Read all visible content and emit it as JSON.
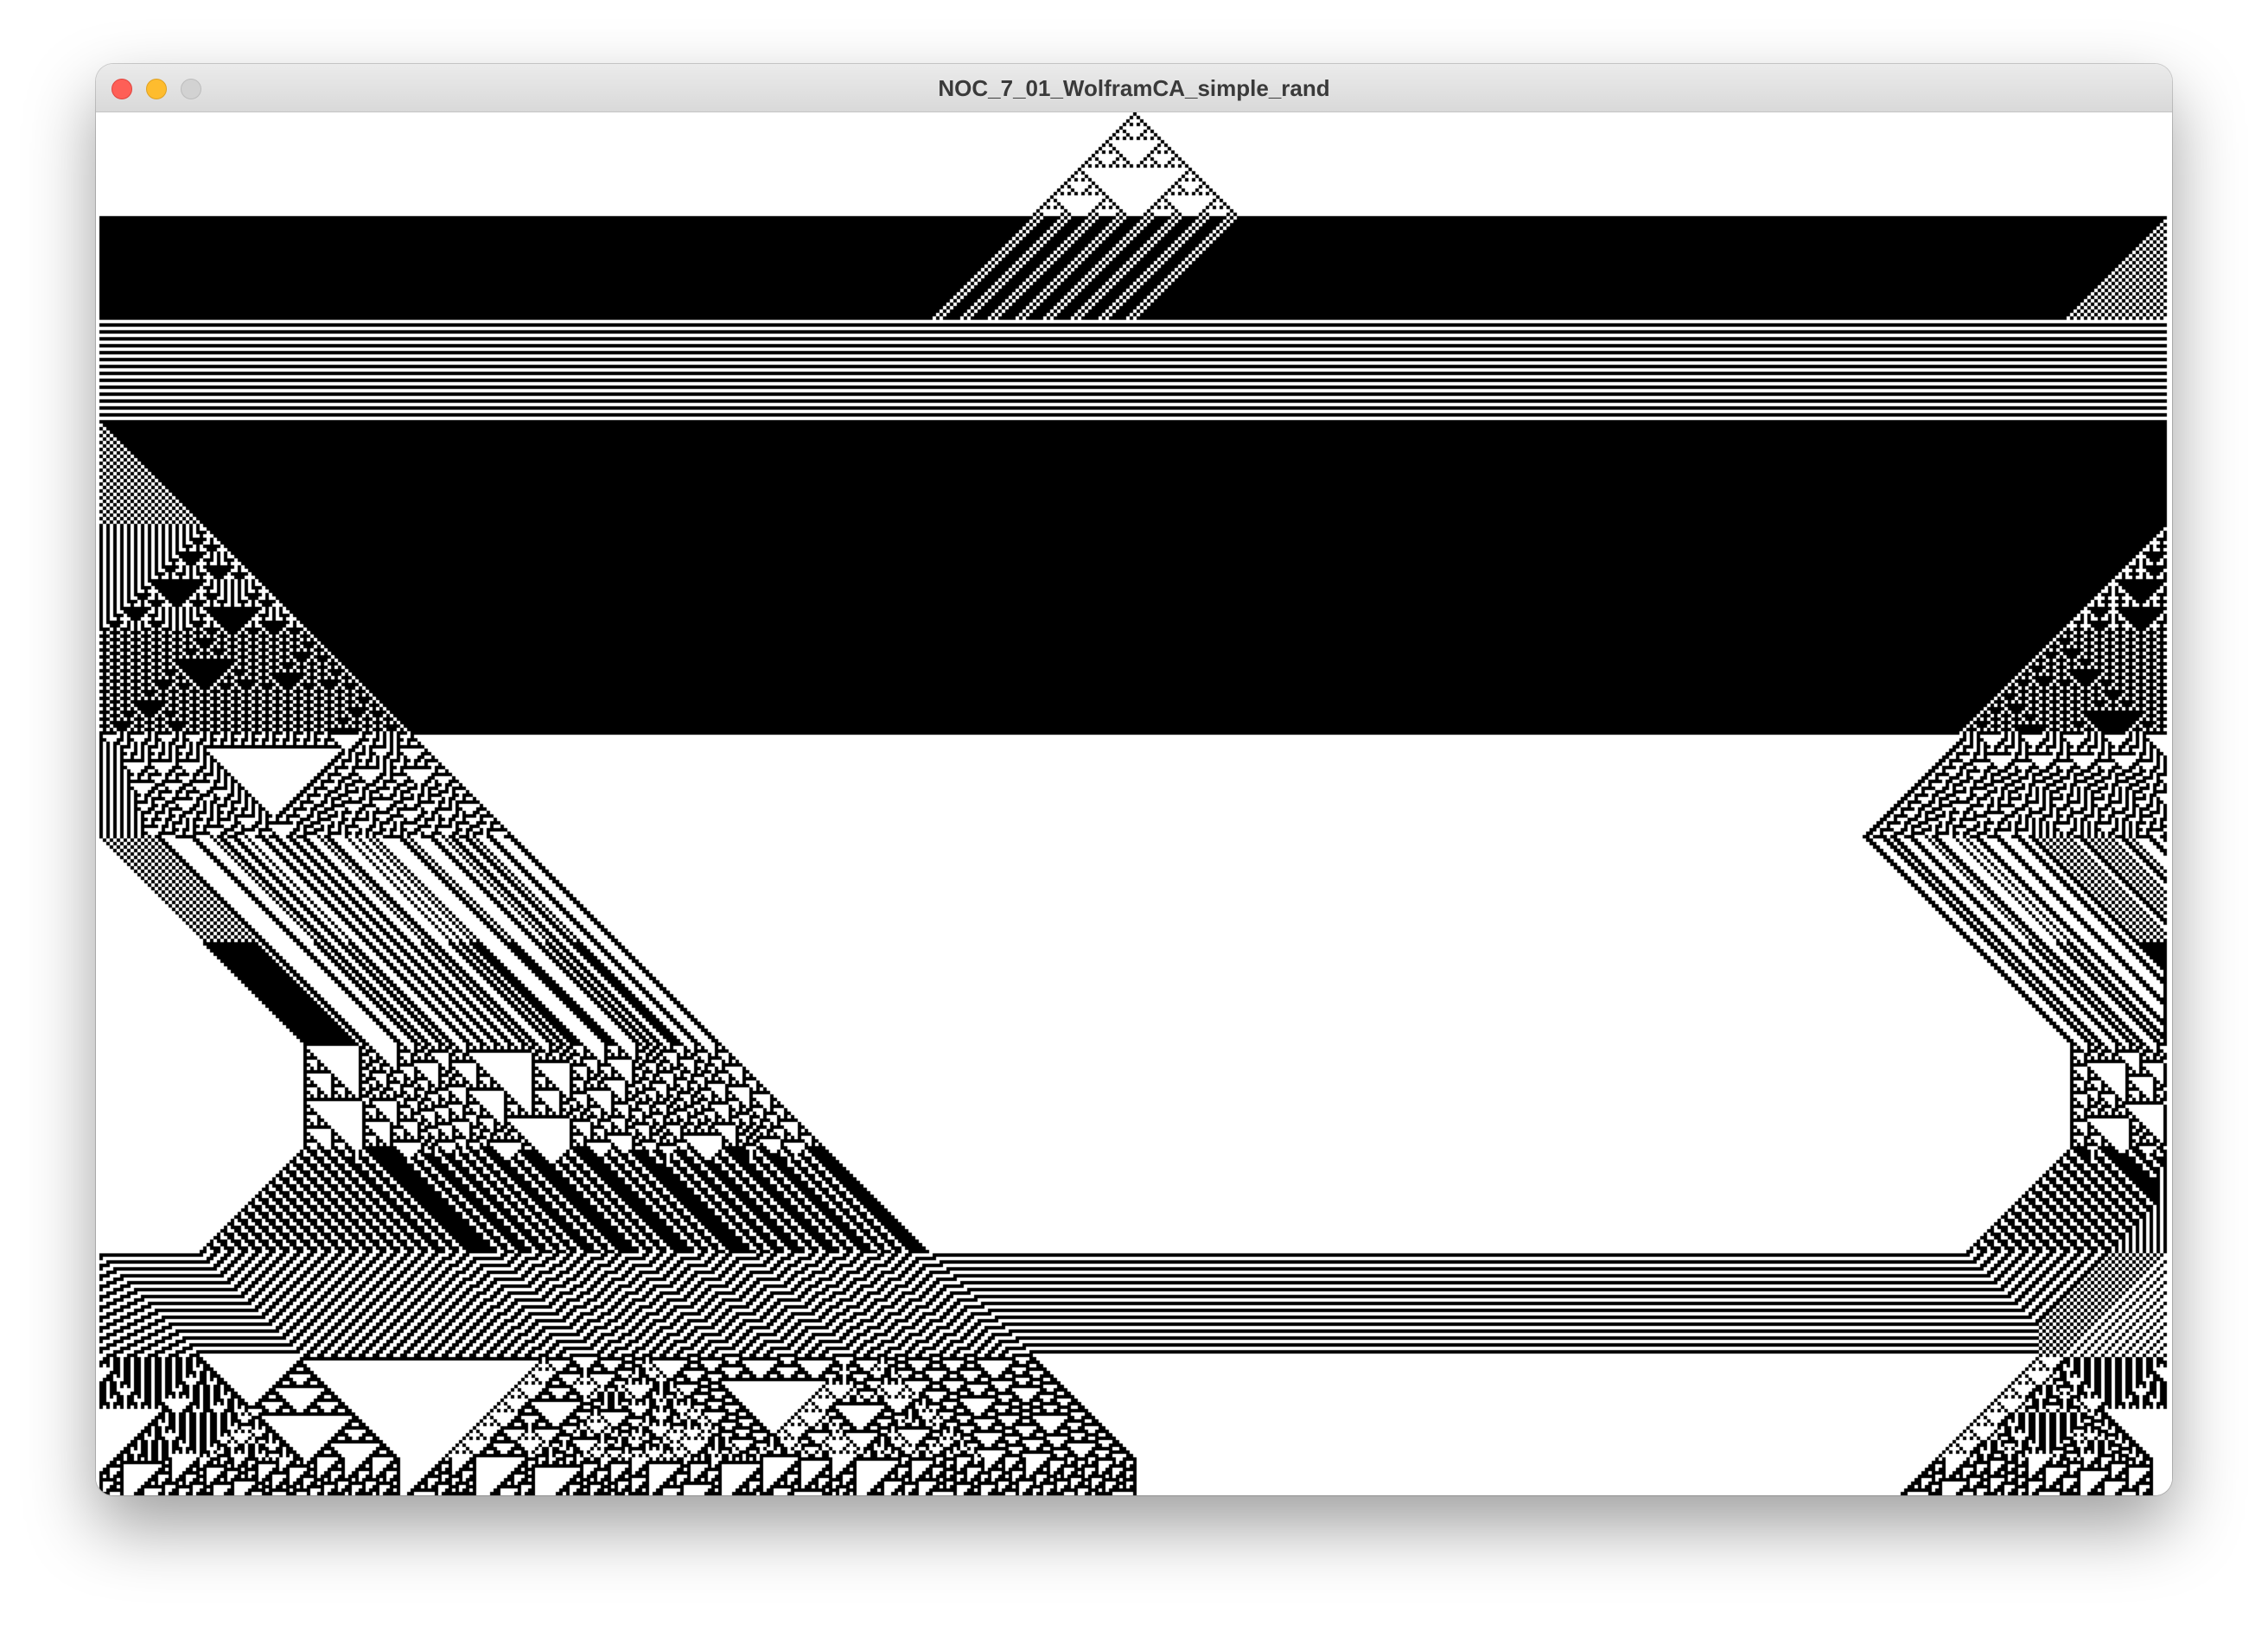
{
  "window": {
    "title": "NOC_7_01_WolframCA_simple_rand"
  },
  "sketch": {
    "description_source": "Processing sketch output",
    "cell_color": "#000000",
    "background_color": "#ffffff"
  }
}
